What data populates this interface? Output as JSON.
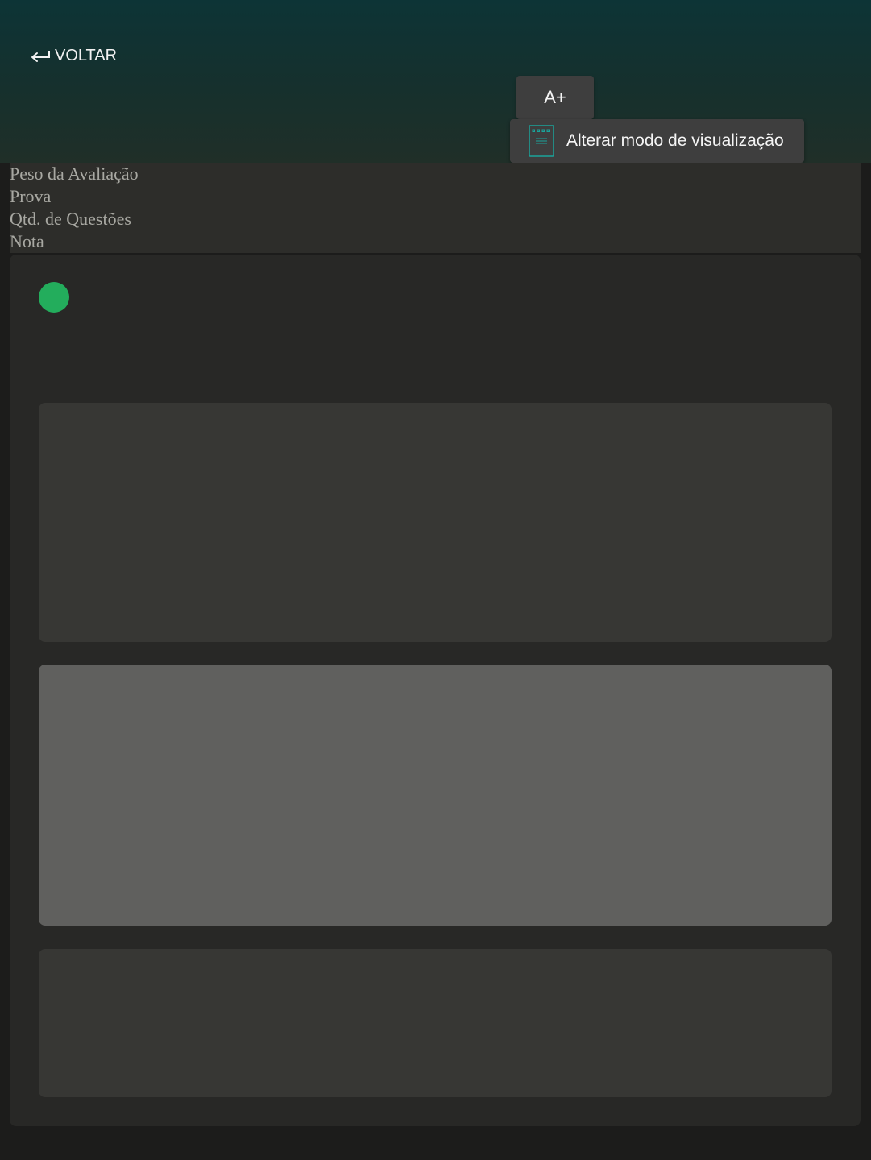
{
  "header": {
    "back_label": "VOLTAR",
    "font_size_button_label": "A+",
    "view_mode_button_label": "Alterar modo de visualização"
  },
  "info": {
    "rows": [
      "Peso da Avaliação",
      "Prova",
      "Qtd. de Questões",
      "Nota"
    ]
  },
  "colors": {
    "accent_teal": "#1aa39a",
    "status_dot": "#23ad5c"
  },
  "icons": {
    "back": "return-arrow-icon",
    "view_mode": "document-icon"
  }
}
